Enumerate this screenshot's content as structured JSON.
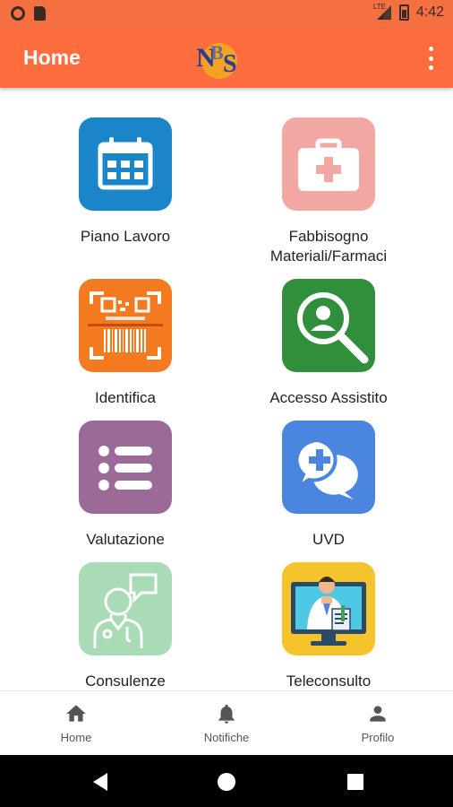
{
  "status_bar": {
    "time": "4:42",
    "network": "LTE"
  },
  "app_bar": {
    "title": "Home",
    "logo_icon": "nbs-logo",
    "menu_icon": "more-vert-icon"
  },
  "grid": [
    {
      "label": "Piano Lavoro",
      "icon": "calendar-icon",
      "color": "#1a86c9"
    },
    {
      "label": "Fabbisogno Materiali/Farmaci",
      "icon": "medical-kit-icon",
      "color": "#f3a7a3"
    },
    {
      "label": "Identifica",
      "icon": "barcode-scan-icon",
      "color": "#f47a1f"
    },
    {
      "label": "Accesso Assistito",
      "icon": "user-search-icon",
      "color": "#2f8f3b"
    },
    {
      "label": "Valutazione",
      "icon": "list-icon",
      "color": "#9c6a96"
    },
    {
      "label": "UVD",
      "icon": "medical-chat-icon",
      "color": "#4a86e0"
    },
    {
      "label": "Consulenze",
      "icon": "doctor-consult-icon",
      "color": "#a8dbb6"
    },
    {
      "label": "Teleconsulto",
      "icon": "doctor-monitor-icon",
      "color": "#f5c42c"
    }
  ],
  "bottom_nav": [
    {
      "label": "Home",
      "icon": "home-icon"
    },
    {
      "label": "Notifiche",
      "icon": "bell-icon"
    },
    {
      "label": "Profilo",
      "icon": "person-icon"
    }
  ],
  "colors": {
    "primary": "#ff6d3f",
    "status_bar": "#f47040"
  }
}
